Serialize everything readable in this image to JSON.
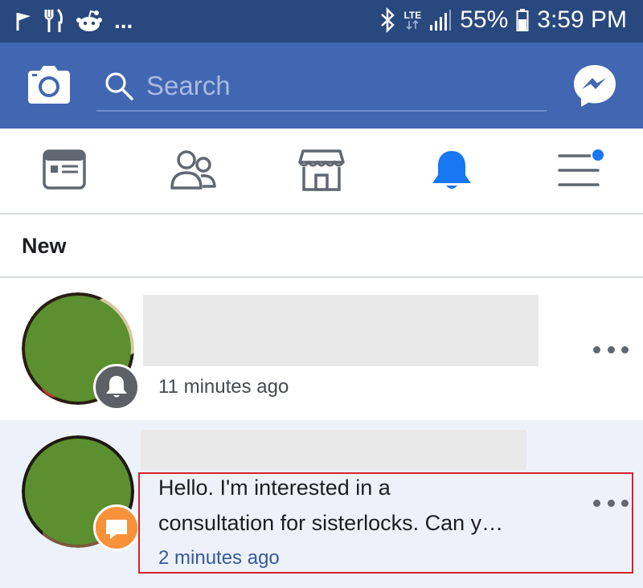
{
  "status_bar": {
    "battery": "55%",
    "time": "3:59 PM",
    "network": "LTE",
    "more": "..."
  },
  "app_bar": {
    "search": {
      "placeholder": "Search",
      "value": ""
    },
    "icons": [
      "camera-icon",
      "search-icon",
      "messenger-icon"
    ]
  },
  "tabs": [
    {
      "name": "news-feed",
      "icon": "news-feed-icon",
      "active": false
    },
    {
      "name": "friends",
      "icon": "friends-icon",
      "active": false
    },
    {
      "name": "marketplace",
      "icon": "marketplace-icon",
      "active": false
    },
    {
      "name": "notifications",
      "icon": "bell-icon",
      "active": true
    },
    {
      "name": "menu",
      "icon": "menu-icon",
      "active": false,
      "badge": true
    }
  ],
  "section": {
    "title": "New"
  },
  "notifications": [
    {
      "time": "11 minutes ago",
      "badge_icon": "bell-icon",
      "unread": false
    },
    {
      "message_line_1": "Hello. I'm interested in a",
      "message_line_2": "consultation for sisterlocks. Can y…",
      "time": "2 minutes ago",
      "badge_icon": "message-icon",
      "unread": true
    }
  ],
  "colors": {
    "status_bar": "#29487d",
    "app_bar": "#4267b2",
    "active_tab": "#1877f2",
    "inactive_icon": "#606770",
    "unread_bg": "#edf2fa",
    "highlight": "#d9212c"
  }
}
